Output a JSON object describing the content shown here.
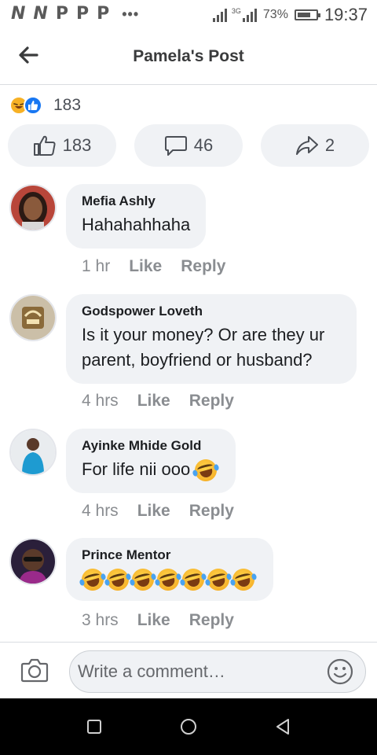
{
  "status_bar": {
    "left_icons": [
      "N",
      "N",
      "P",
      "P",
      "P"
    ],
    "more": "•••",
    "network": "3G",
    "battery_percent": "73%",
    "battery_level": 0.73,
    "time": "19:37"
  },
  "header": {
    "title": "Pamela's Post",
    "back_icon": "arrow-left-icon"
  },
  "reactions": {
    "icons": [
      "haha-icon",
      "like-icon"
    ],
    "count": "183"
  },
  "actions": {
    "like_count": "183",
    "comment_count": "46",
    "share_count": "2"
  },
  "comments": [
    {
      "name": "Mefia Ashly",
      "text": "Hahahahhaha",
      "time": "1 hr",
      "like": "Like",
      "reply": "Reply"
    },
    {
      "name": "Godspower Loveth",
      "text": "Is it your money? Or are they ur parent, boyfriend or husband?",
      "time": "4 hrs",
      "like": "Like",
      "reply": "Reply"
    },
    {
      "name": "Ayinke Mhide Gold",
      "text": "For life nii ooo",
      "emoji_count": 1,
      "time": "4 hrs",
      "like": "Like",
      "reply": "Reply"
    },
    {
      "name": "Prince Mentor",
      "text": "",
      "emoji_count": 7,
      "time": "3 hrs",
      "like": "Like",
      "reply": "Reply"
    }
  ],
  "composer": {
    "placeholder": "Write a comment…"
  },
  "colors": {
    "accent": "#1877f2",
    "haha": "#f7b125",
    "bubble": "#f0f2f5",
    "meta": "#8a8d91"
  }
}
